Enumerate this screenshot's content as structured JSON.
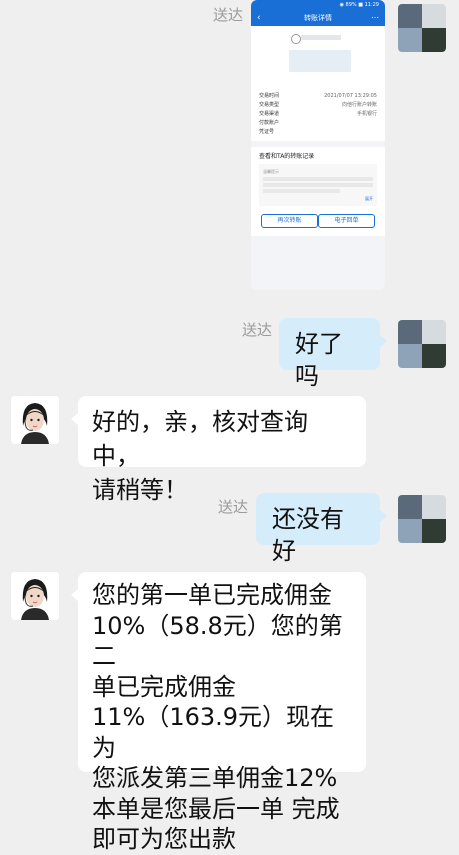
{
  "messages": [
    {
      "side": "me",
      "status": "送达",
      "kind": "image"
    },
    {
      "side": "me",
      "status": "送达",
      "text": "好了吗"
    },
    {
      "side": "them",
      "lines": [
        "好的，亲，核对查询中，",
        "请稍等！"
      ]
    },
    {
      "side": "me",
      "status": "送达",
      "text": "还没有好"
    },
    {
      "side": "them",
      "lines": [
        "您的第一单已完成佣金",
        "10%（58.8元）您的第二",
        "单已完成佣金",
        "11%（163.9元）现在为",
        "您派发第三单佣金12%",
        "本单是您最后一单  完成",
        "即可为您出款"
      ]
    }
  ],
  "screenshot": {
    "status_bar": "◉ 89% ■ 11:29",
    "nav_title": "转账详情",
    "amount_masked": "",
    "rows": [
      {
        "label": "交易时间",
        "value": "2021/07/07  13:29:05"
      },
      {
        "label": "交易类型",
        "value": "向他行账户转账"
      },
      {
        "label": "交易渠道",
        "value": "手机银行"
      },
      {
        "label": "付款账户",
        "value": ""
      },
      {
        "label": "凭证号",
        "value": ""
      }
    ],
    "section_title": "查看和TA的转账记录",
    "tip_title": "温馨提示",
    "tip_text": "",
    "tip_more": "展开",
    "button_retransfer": "再次转账",
    "button_receipt": "电子回单"
  },
  "colors": {
    "bubble_me": "#d5ecfb",
    "bubble_them": "#ffffff",
    "brand_blue": "#1a6fd6",
    "background": "#efefef"
  },
  "icons": {
    "back": "back-arrow-icon",
    "share": "share-icon"
  }
}
